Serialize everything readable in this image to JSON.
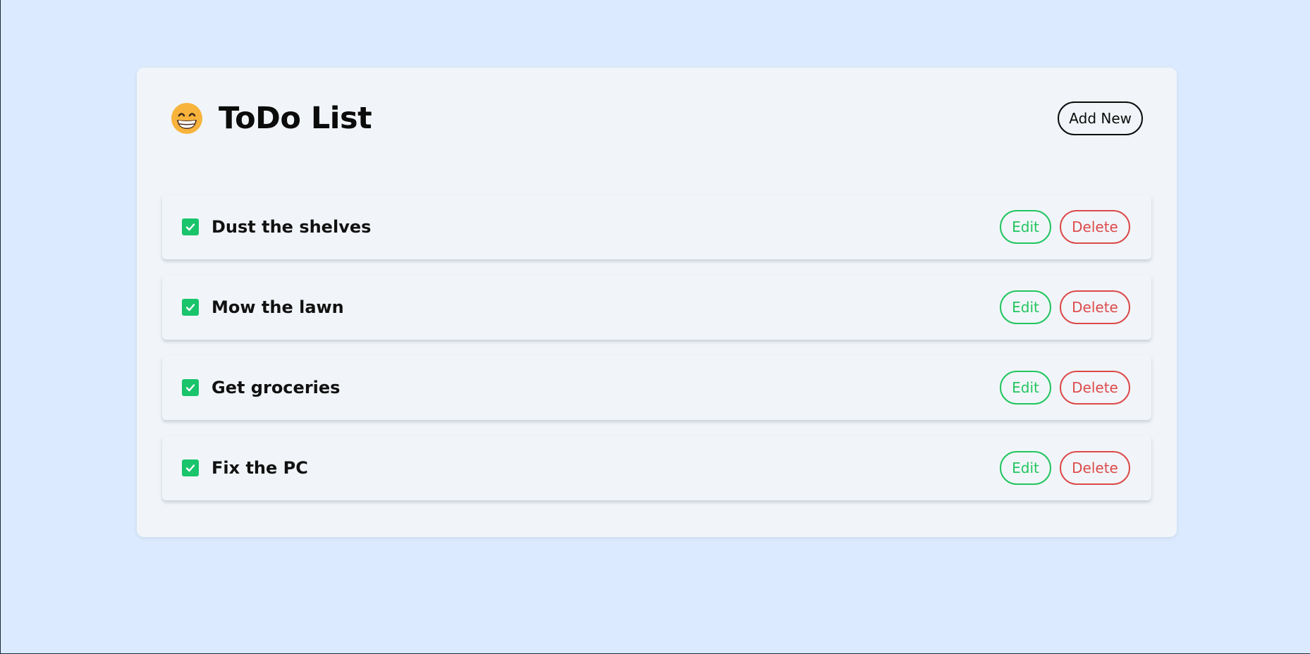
{
  "app": {
    "title": "ToDo List",
    "title_icon": "grinning-face-icon",
    "add_button_label": "Add New"
  },
  "todos": [
    {
      "text": "Dust the shelves",
      "checked": true,
      "edit_label": "Edit",
      "delete_label": "Delete"
    },
    {
      "text": "Mow the lawn",
      "checked": true,
      "edit_label": "Edit",
      "delete_label": "Delete"
    },
    {
      "text": "Get groceries",
      "checked": true,
      "edit_label": "Edit",
      "delete_label": "Delete"
    },
    {
      "text": "Fix the PC",
      "checked": true,
      "edit_label": "Edit",
      "delete_label": "Delete"
    }
  ],
  "colors": {
    "background": "#dbeafe",
    "card": "#f1f5f9",
    "checkbox": "#19c46b",
    "edit": "#22c55e",
    "delete": "#dc4a4a"
  }
}
